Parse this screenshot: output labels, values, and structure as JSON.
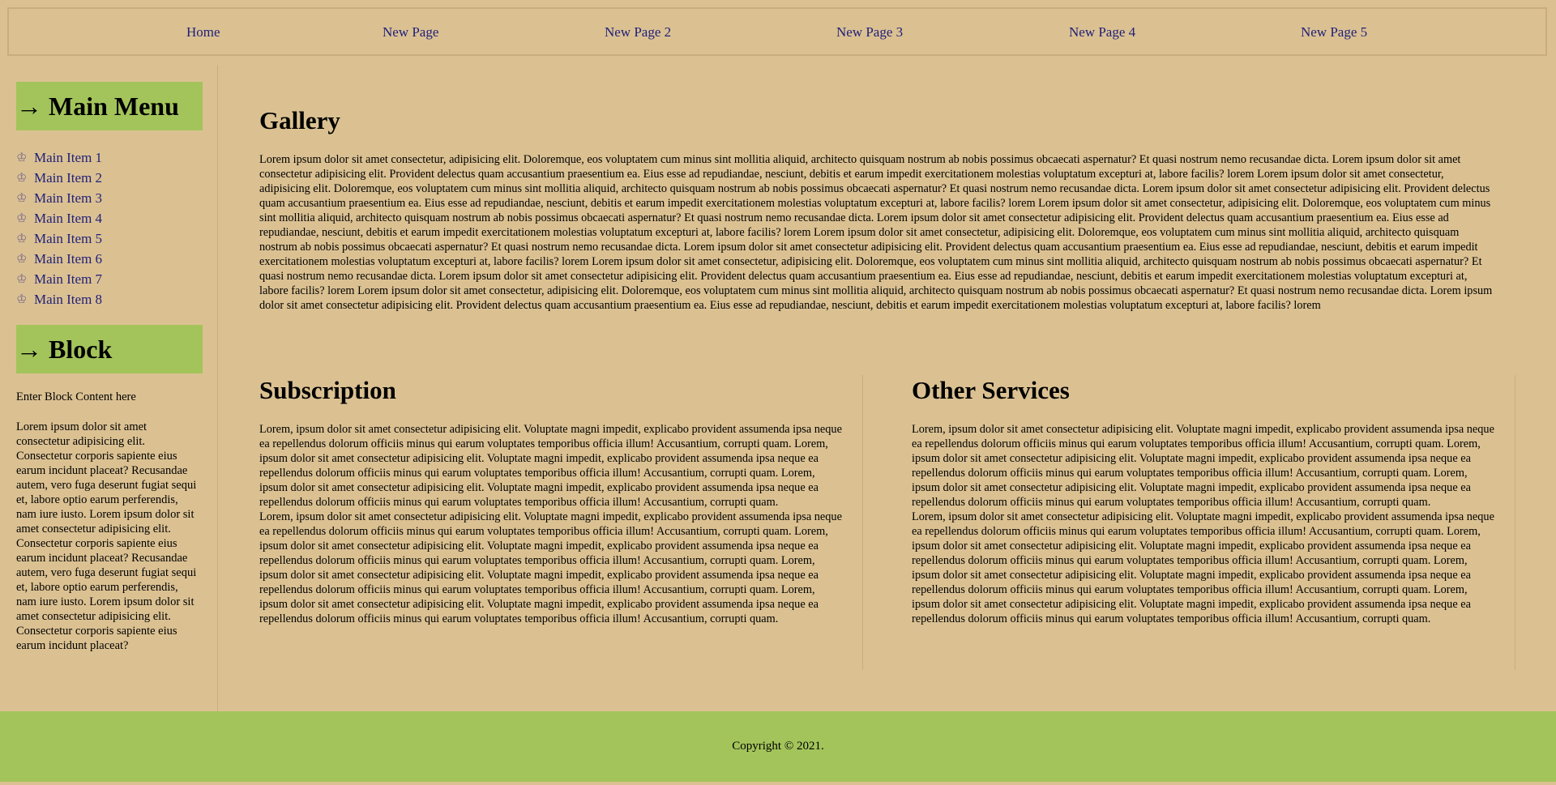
{
  "nav": {
    "items": [
      "Home",
      "New Page",
      "New Page 2",
      "New Page 3",
      "New Page 4",
      "New Page 5"
    ]
  },
  "sidebar": {
    "menu_heading": "→ Main Menu",
    "items": [
      "Main Item 1",
      "Main Item 2",
      "Main Item 3",
      "Main Item 4",
      "Main Item 5",
      "Main Item 6",
      "Main Item 7",
      "Main Item 8"
    ],
    "item_icon": "crown-icon",
    "block_heading": "→ Block",
    "block_intro": "Enter Block Content here",
    "block_body": "Lorem ipsum dolor sit amet consectetur adipisicing elit. Consectetur corporis sapiente eius earum incidunt placeat? Recusandae autem, vero fuga deserunt fugiat sequi et, labore optio earum perferendis, nam iure iusto. Lorem ipsum dolor sit amet consectetur adipisicing elit. Consectetur corporis sapiente eius earum incidunt placeat? Recusandae autem, vero fuga deserunt fugiat sequi et, labore optio earum perferendis, nam iure iusto. Lorem ipsum dolor sit amet consectetur adipisicing elit. Consectetur corporis sapiente eius earum incidunt placeat?"
  },
  "gallery": {
    "title": "Gallery",
    "text": "Lorem ipsum dolor sit amet consectetur, adipisicing elit. Doloremque, eos voluptatem cum minus sint mollitia aliquid, architecto quisquam nostrum ab nobis possimus obcaecati aspernatur? Et quasi nostrum nemo recusandae dicta. Lorem ipsum dolor sit amet consectetur adipisicing elit. Provident delectus quam accusantium praesentium ea. Eius esse ad repudiandae, nesciunt, debitis et earum impedit exercitationem molestias voluptatum excepturi at, labore facilis? lorem Lorem ipsum dolor sit amet consectetur, adipisicing elit. Doloremque, eos voluptatem cum minus sint mollitia aliquid, architecto quisquam nostrum ab nobis possimus obcaecati aspernatur? Et quasi nostrum nemo recusandae dicta. Lorem ipsum dolor sit amet consectetur adipisicing elit. Provident delectus quam accusantium praesentium ea. Eius esse ad repudiandae, nesciunt, debitis et earum impedit exercitationem molestias voluptatum excepturi at, labore facilis? lorem Lorem ipsum dolor sit amet consectetur, adipisicing elit. Doloremque, eos voluptatem cum minus sint mollitia aliquid, architecto quisquam nostrum ab nobis possimus obcaecati aspernatur? Et quasi nostrum nemo recusandae dicta. Lorem ipsum dolor sit amet consectetur adipisicing elit. Provident delectus quam accusantium praesentium ea. Eius esse ad repudiandae, nesciunt, debitis et earum impedit exercitationem molestias voluptatum excepturi at, labore facilis? lorem Lorem ipsum dolor sit amet consectetur, adipisicing elit. Doloremque, eos voluptatem cum minus sint mollitia aliquid, architecto quisquam nostrum ab nobis possimus obcaecati aspernatur? Et quasi nostrum nemo recusandae dicta. Lorem ipsum dolor sit amet consectetur adipisicing elit. Provident delectus quam accusantium praesentium ea. Eius esse ad repudiandae, nesciunt, debitis et earum impedit exercitationem molestias voluptatum excepturi at, labore facilis? lorem Lorem ipsum dolor sit amet consectetur, adipisicing elit. Doloremque, eos voluptatem cum minus sint mollitia aliquid, architecto quisquam nostrum ab nobis possimus obcaecati aspernatur? Et quasi nostrum nemo recusandae dicta. Lorem ipsum dolor sit amet consectetur adipisicing elit. Provident delectus quam accusantium praesentium ea. Eius esse ad repudiandae, nesciunt, debitis et earum impedit exercitationem molestias voluptatum excepturi at, labore facilis? lorem Lorem ipsum dolor sit amet consectetur, adipisicing elit. Doloremque, eos voluptatem cum minus sint mollitia aliquid, architecto quisquam nostrum ab nobis possimus obcaecati aspernatur? Et quasi nostrum nemo recusandae dicta. Lorem ipsum dolor sit amet consectetur adipisicing elit. Provident delectus quam accusantium praesentium ea. Eius esse ad repudiandae, nesciunt, debitis et earum impedit exercitationem molestias voluptatum excepturi at, labore facilis? lorem"
  },
  "subscription": {
    "title": "Subscription",
    "p1": "Lorem, ipsum dolor sit amet consectetur adipisicing elit. Voluptate magni impedit, explicabo provident assumenda ipsa neque ea repellendus dolorum officiis minus qui earum voluptates temporibus officia illum! Accusantium, corrupti quam. Lorem, ipsum dolor sit amet consectetur adipisicing elit. Voluptate magni impedit, explicabo provident assumenda ipsa neque ea repellendus dolorum officiis minus qui earum voluptates temporibus officia illum! Accusantium, corrupti quam. Lorem, ipsum dolor sit amet consectetur adipisicing elit. Voluptate magni impedit, explicabo provident assumenda ipsa neque ea repellendus dolorum officiis minus qui earum voluptates temporibus officia illum! Accusantium, corrupti quam.",
    "p2": "Lorem, ipsum dolor sit amet consectetur adipisicing elit. Voluptate magni impedit, explicabo provident assumenda ipsa neque ea repellendus dolorum officiis minus qui earum voluptates temporibus officia illum! Accusantium, corrupti quam. Lorem, ipsum dolor sit amet consectetur adipisicing elit. Voluptate magni impedit, explicabo provident assumenda ipsa neque ea repellendus dolorum officiis minus qui earum voluptates temporibus officia illum! Accusantium, corrupti quam. Lorem, ipsum dolor sit amet consectetur adipisicing elit. Voluptate magni impedit, explicabo provident assumenda ipsa neque ea repellendus dolorum officiis minus qui earum voluptates temporibus officia illum! Accusantium, corrupti quam. Lorem, ipsum dolor sit amet consectetur adipisicing elit. Voluptate magni impedit, explicabo provident assumenda ipsa neque ea repellendus dolorum officiis minus qui earum voluptates temporibus officia illum! Accusantium, corrupti quam."
  },
  "services": {
    "title": "Other Services",
    "p1": "Lorem, ipsum dolor sit amet consectetur adipisicing elit. Voluptate magni impedit, explicabo provident assumenda ipsa neque ea repellendus dolorum officiis minus qui earum voluptates temporibus officia illum! Accusantium, corrupti quam. Lorem, ipsum dolor sit amet consectetur adipisicing elit. Voluptate magni impedit, explicabo provident assumenda ipsa neque ea repellendus dolorum officiis minus qui earum voluptates temporibus officia illum! Accusantium, corrupti quam. Lorem, ipsum dolor sit amet consectetur adipisicing elit. Voluptate magni impedit, explicabo provident assumenda ipsa neque ea repellendus dolorum officiis minus qui earum voluptates temporibus officia illum! Accusantium, corrupti quam.",
    "p2": "Lorem, ipsum dolor sit amet consectetur adipisicing elit. Voluptate magni impedit, explicabo provident assumenda ipsa neque ea repellendus dolorum officiis minus qui earum voluptates temporibus officia illum! Accusantium, corrupti quam. Lorem, ipsum dolor sit amet consectetur adipisicing elit. Voluptate magni impedit, explicabo provident assumenda ipsa neque ea repellendus dolorum officiis minus qui earum voluptates temporibus officia illum! Accusantium, corrupti quam. Lorem, ipsum dolor sit amet consectetur adipisicing elit. Voluptate magni impedit, explicabo provident assumenda ipsa neque ea repellendus dolorum officiis minus qui earum voluptates temporibus officia illum! Accusantium, corrupti quam. Lorem, ipsum dolor sit amet consectetur adipisicing elit. Voluptate magni impedit, explicabo provident assumenda ipsa neque ea repellendus dolorum officiis minus qui earum voluptates temporibus officia illum! Accusantium, corrupti quam."
  },
  "footer": {
    "copyright": "Copyright © 2021."
  },
  "colors": {
    "background": "#dbc192",
    "accent_green": "#a3c45a",
    "link": "#20207a"
  }
}
